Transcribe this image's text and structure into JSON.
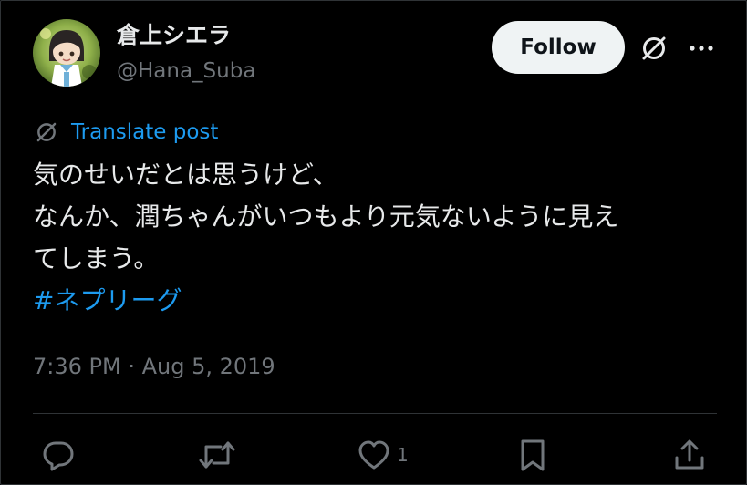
{
  "user": {
    "display_name": "倉上シエラ",
    "handle": "@Hana_Suba"
  },
  "header": {
    "follow_label": "Follow",
    "grok_icon": "grok-slash-circle-icon",
    "more_icon": "more-dots-icon"
  },
  "translate": {
    "label": "Translate post",
    "icon": "grok-slash-circle-icon"
  },
  "post": {
    "lines": [
      "気のせいだとは思うけど、",
      "なんか、潤ちゃんがいつもより元気ないように見え",
      "てしまう。"
    ],
    "hashtag": "#ネプリーグ"
  },
  "meta": {
    "timestamp": "7:36 PM · Aug 5, 2019"
  },
  "actions": {
    "reply_icon": "reply-bubble-icon",
    "repost_icon": "repost-arrows-icon",
    "like_icon": "heart-icon",
    "like_count": "1",
    "bookmark_icon": "bookmark-icon",
    "share_icon": "share-upload-icon"
  },
  "colors": {
    "background": "#000000",
    "text": "#e7e9ea",
    "secondary": "#71767b",
    "accent": "#1d9bf0",
    "follow_bg": "#eff3f4",
    "border": "#2f3336"
  }
}
